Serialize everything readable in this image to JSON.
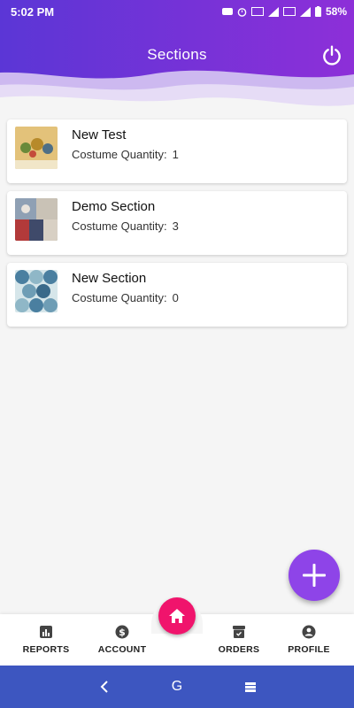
{
  "status_bar": {
    "time": "5:02 PM",
    "battery": "58%"
  },
  "header": {
    "title": "Sections",
    "power_icon": "power-icon",
    "gradient_start": "#5b36d6",
    "gradient_end": "#8d2fd8"
  },
  "sections": [
    {
      "name": "New Test",
      "quantity_label": "Costume Quantity:",
      "quantity": "1"
    },
    {
      "name": "Demo Section",
      "quantity_label": "Costume Quantity:",
      "quantity": "3"
    },
    {
      "name": "New Section",
      "quantity_label": "Costume Quantity:",
      "quantity": "0"
    }
  ],
  "fab": {
    "icon": "plus-icon",
    "color": "#8e44e8"
  },
  "bottom_nav": {
    "items": [
      {
        "label": "REPORTS",
        "icon": "reports-icon"
      },
      {
        "label": "ACCOUNT",
        "icon": "dollar-icon"
      },
      {
        "label": "ORDERS",
        "icon": "box-icon"
      },
      {
        "label": "PROFILE",
        "icon": "person-icon"
      }
    ],
    "home_icon": "home-icon",
    "home_color": "#f0146c"
  },
  "system_nav": {
    "back_icon": "back-icon",
    "home_label": "G",
    "recents_icon": "recents-icon",
    "color": "#3d56c0"
  }
}
